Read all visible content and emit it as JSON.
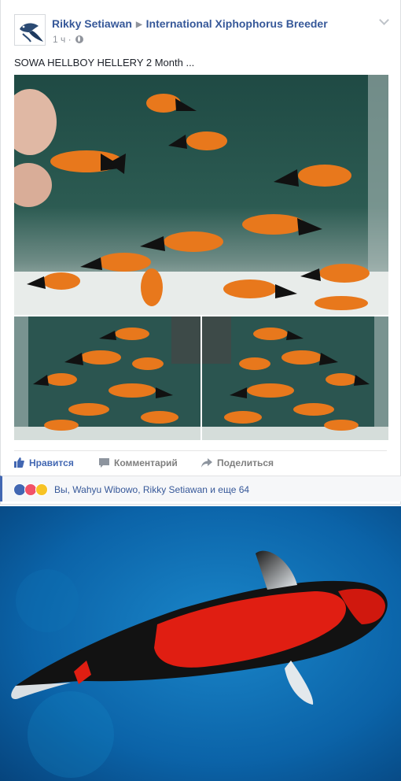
{
  "post": {
    "author": "Rikky Setiawan",
    "group": "International Xiphophorus Breeder",
    "time": "1 ч",
    "separator": "·",
    "text": "SOWA HELLBOY HELLERY 2 Month ...",
    "privacy_icon": "globe-icon",
    "options_icon": "chevron-down-icon"
  },
  "actions": {
    "like": "Нравится",
    "comment": "Комментарий",
    "share": "Поделиться"
  },
  "reactions": {
    "summary": "Вы, Wahyu Wibowo, Rikky Setiawan и еще 64",
    "icons": [
      "like-reaction-icon",
      "love-reaction-icon",
      "wow-reaction-icon"
    ]
  },
  "colors": {
    "link_blue": "#365899",
    "like_blue": "#4267b2",
    "muted_gray": "#90949c",
    "fish_orange": "#e8781c",
    "koi_red": "#e01e12",
    "water_blue": "#0b63a8"
  }
}
